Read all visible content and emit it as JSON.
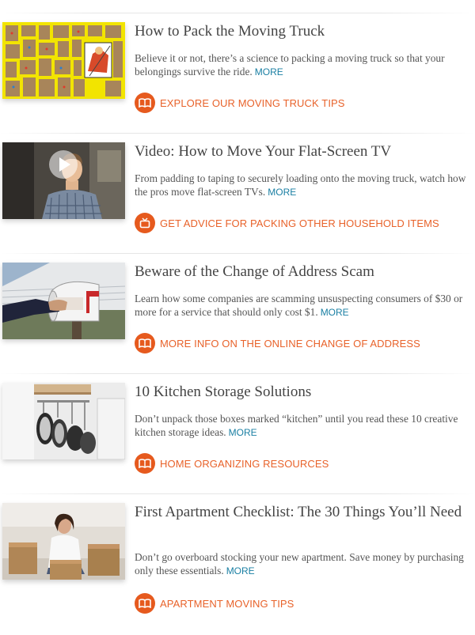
{
  "articles": [
    {
      "title": "How to Pack the Moving Truck",
      "description": "Believe it or not, there’s a science to packing a moving truck so that your belongings survive the ride.",
      "more_label": "MORE",
      "cta_label": "EXPLORE OUR MOVING TRUCK TIPS",
      "cta_icon": "book-icon",
      "thumbnail": "moving-truck-illustration"
    },
    {
      "title": "Video: How to Move Your Flat-Screen TV",
      "description": "From padding to taping to securely loading onto the moving truck, watch how the pros move flat-screen TVs.",
      "more_label": "MORE",
      "cta_label": "GET ADVICE FOR PACKING OTHER HOUSEHOLD ITEMS",
      "cta_icon": "tv-icon",
      "thumbnail": "video-presenter"
    },
    {
      "title": "Beware of the Change of Address Scam",
      "description": "Learn how some companies are scamming unsuspecting consumers of $30 or more for a service that should only cost $1.",
      "more_label": "MORE",
      "cta_label": "MORE INFO ON THE ONLINE CHANGE OF ADDRESS",
      "cta_icon": "book-icon",
      "thumbnail": "mailbox"
    },
    {
      "title": "10 Kitchen Storage Solutions",
      "description": "Don’t unpack those boxes marked “kitchen” until you read these 10 creative kitchen storage ideas.",
      "more_label": "MORE",
      "cta_label": "HOME ORGANIZING RESOURCES",
      "cta_icon": "book-icon",
      "thumbnail": "hanging-pans"
    },
    {
      "title": "First Apartment Checklist: The 30 Things You’ll Need",
      "description": "Don’t go overboard stocking your new apartment. Save money by purchasing only these essentials.",
      "more_label": "MORE",
      "cta_label": "APARTMENT MOVING TIPS",
      "cta_icon": "book-icon",
      "thumbnail": "woman-with-boxes"
    }
  ],
  "colors": {
    "accent": "#e65a1e",
    "link": "#1a7fa3",
    "title": "#444444"
  }
}
